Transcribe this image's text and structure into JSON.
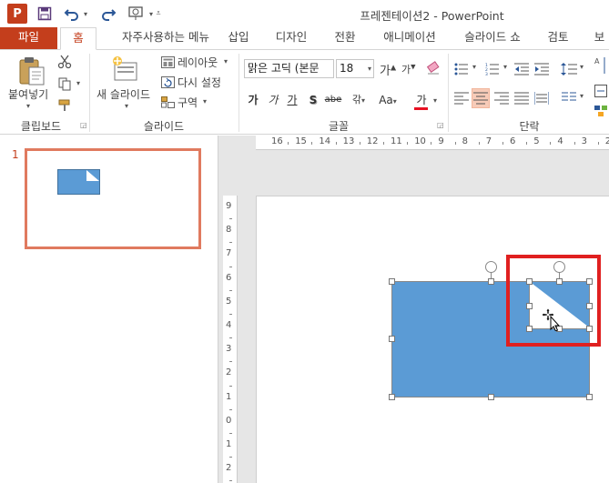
{
  "titlebar": {
    "app_logo": "P",
    "title": "프레젠테이션2 - PowerPoint"
  },
  "tabs": [
    {
      "label": "파일"
    },
    {
      "label": "홈"
    },
    {
      "label": "자주사용하는 메뉴"
    },
    {
      "label": "삽입"
    },
    {
      "label": "디자인"
    },
    {
      "label": "전환"
    },
    {
      "label": "애니메이션"
    },
    {
      "label": "슬라이드 쇼"
    },
    {
      "label": "검토"
    },
    {
      "label": "보"
    }
  ],
  "ribbon": {
    "clipboard": {
      "paste": "붙여넣기",
      "label": "클립보드"
    },
    "slides": {
      "new_slide": "새 슬라이드",
      "layout": "레이아웃",
      "reset": "다시 설정",
      "section": "구역",
      "label": "슬라이드"
    },
    "font": {
      "family": "맑은 고딕 (본문",
      "size": "18",
      "grow": "가",
      "shrink": "가",
      "bold": "가",
      "italic": "가",
      "underline": "가",
      "shadow": "S",
      "strike": "abe",
      "spacing": "갂",
      "case": "Aa",
      "color": "가",
      "label": "글꼴"
    },
    "paragraph": {
      "label": "단락"
    },
    "accent": "#c43e1c",
    "font_color_underline": "#e81123"
  },
  "thumbnails": [
    {
      "number": "1"
    }
  ],
  "rulers": {
    "horizontal": [
      "16",
      "15",
      "14",
      "13",
      "12",
      "11",
      "10",
      "9",
      "8",
      "7",
      "6",
      "5",
      "4",
      "3",
      "2"
    ],
    "vertical": [
      "9",
      "8",
      "7",
      "6",
      "5",
      "4",
      "3",
      "2",
      "1",
      "0",
      "1",
      "2"
    ]
  },
  "slide": {
    "shape_fill": "#5b9bd5",
    "shape_border": "#41719c",
    "highlight_color": "#e02020"
  }
}
